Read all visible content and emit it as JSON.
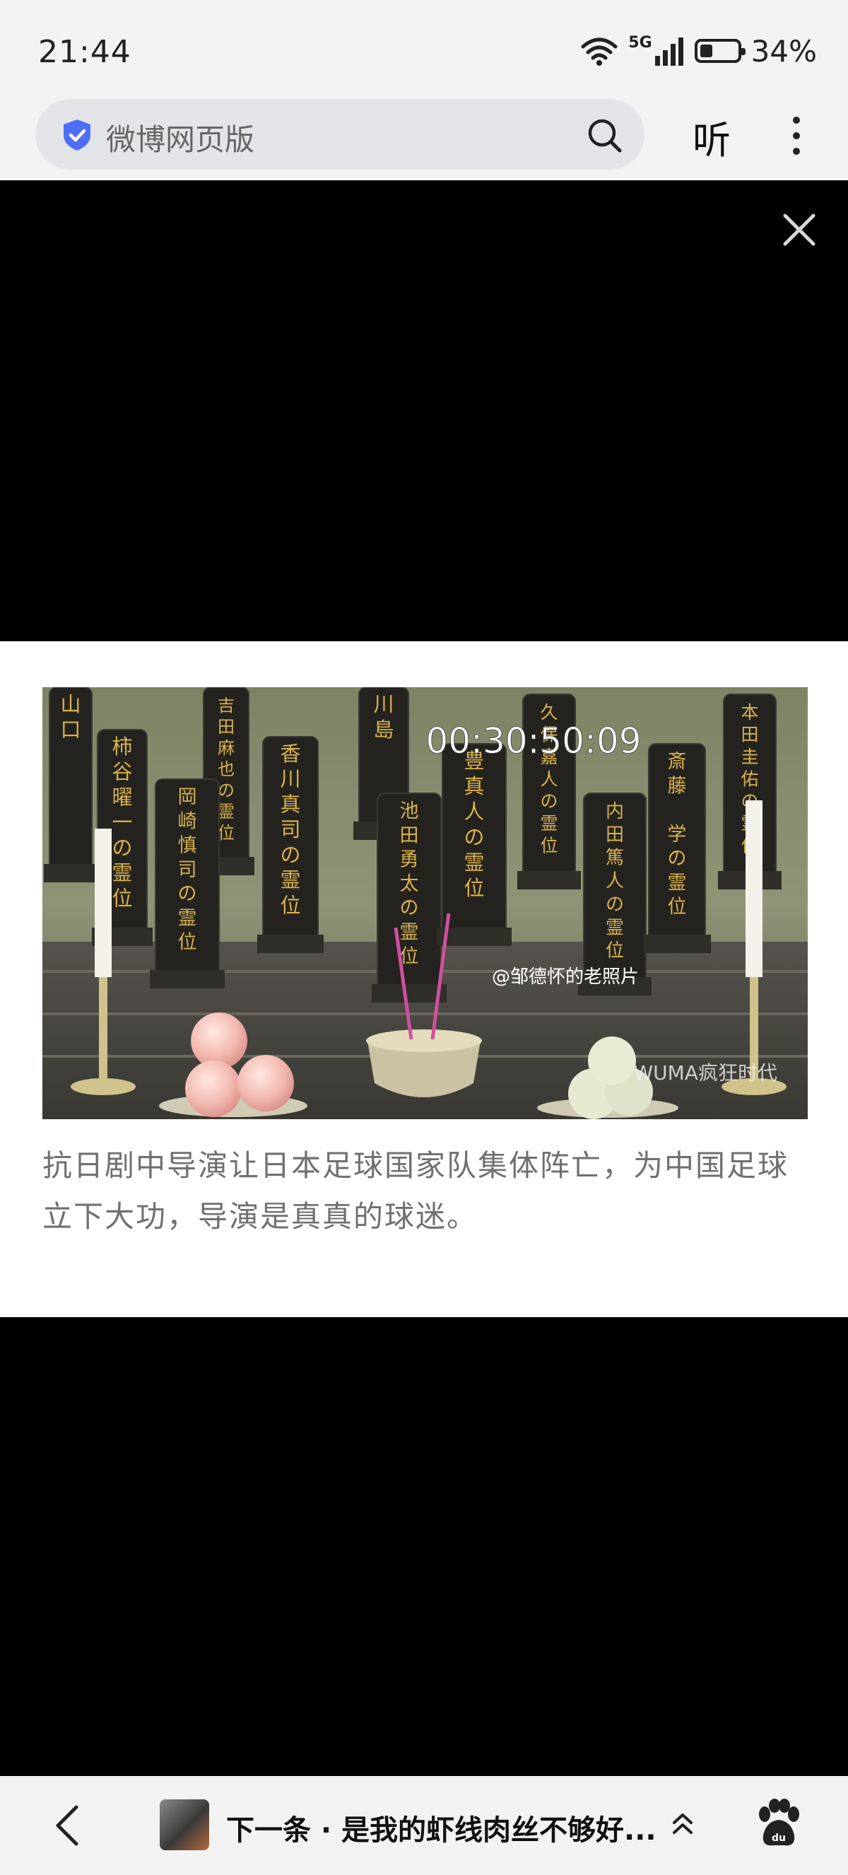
{
  "status_bar": {
    "time": "21:44",
    "network": "5G",
    "battery_percent": "34%",
    "battery_level": 0.34
  },
  "search_bar": {
    "text": "微博网页版",
    "listen_label": "听"
  },
  "post": {
    "image_overlay": {
      "timecode": "00:30:50:09",
      "watermark_weibo": "@邹德怀的老照片",
      "watermark_wechat": "WUMA疯狂时代",
      "tablets": [
        "山口",
        "柿谷曜一の霊位",
        "吉田麻也の霊位",
        "岡崎慎司の霊位",
        "香川真司の霊位",
        "川島",
        "池田勇太の霊位",
        "豊真人の霊位",
        "久保嘉人の霊位",
        "内田篤人の霊位",
        "斎藤 学の霊位",
        "本田圭佑の霊位"
      ]
    },
    "caption": "抗日剧中导演让日本足球国家队集体阵亡，为中国足球立下大功，导演是真真的球迷。"
  },
  "bottom_nav": {
    "next_label": "下一条 · 是我的虾线肉丝不够好..."
  },
  "colors": {
    "accent_shield": "#4f6ef7",
    "caption_text": "#707070",
    "gold_text": "#d9b24a",
    "incense": "#d04fa0"
  }
}
